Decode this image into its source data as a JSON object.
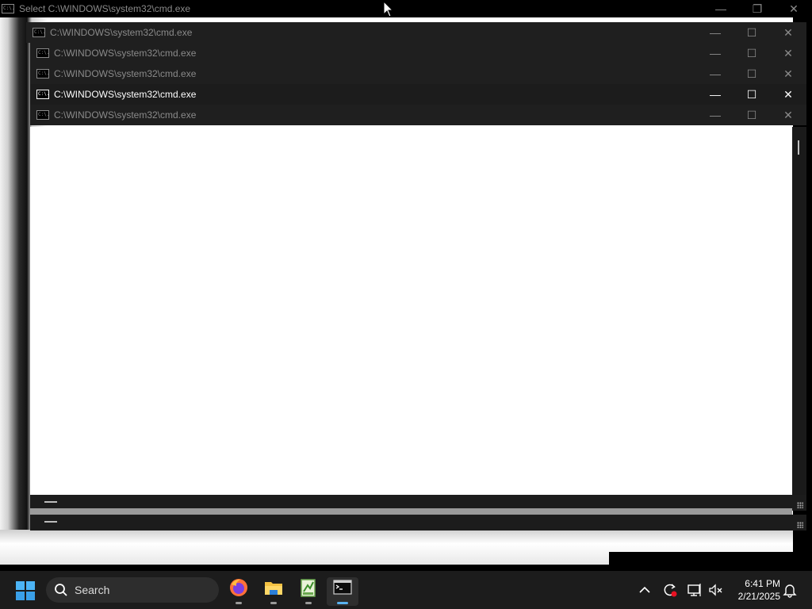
{
  "windows": {
    "back_title": "Select C:\\WINDOWS\\system32\\cmd.exe",
    "stack": [
      {
        "title": "C:\\WINDOWS\\system32\\cmd.exe",
        "state": "inactive"
      },
      {
        "title": "C:\\WINDOWS\\system32\\cmd.exe",
        "state": "inactive"
      },
      {
        "title": "C:\\WINDOWS\\system32\\cmd.exe",
        "state": "inactive"
      },
      {
        "title": "C:\\WINDOWS\\system32\\cmd.exe",
        "state": "active"
      },
      {
        "title": "C:\\WINDOWS\\system32\\cmd.exe",
        "state": "inactive"
      }
    ],
    "icon_text": "C:\\."
  },
  "controls": {
    "minimize_icon": "minimize-icon",
    "maximize_icon": "maximize-icon",
    "close_icon": "close-icon",
    "minimize_glyph": "—",
    "maximize_glyph": "☐",
    "close_glyph": "✕"
  },
  "taskbar": {
    "search_label": "Search",
    "apps": [
      "firefox",
      "file-explorer",
      "notepad-plus-plus",
      "terminal"
    ],
    "tray": {
      "time": "6:41 PM",
      "date": "2/21/2025"
    }
  },
  "colors": {
    "taskbar_bg": "#1c1c1c",
    "accent": "#5ab2f0",
    "win_blue": "#3d8ee0"
  }
}
